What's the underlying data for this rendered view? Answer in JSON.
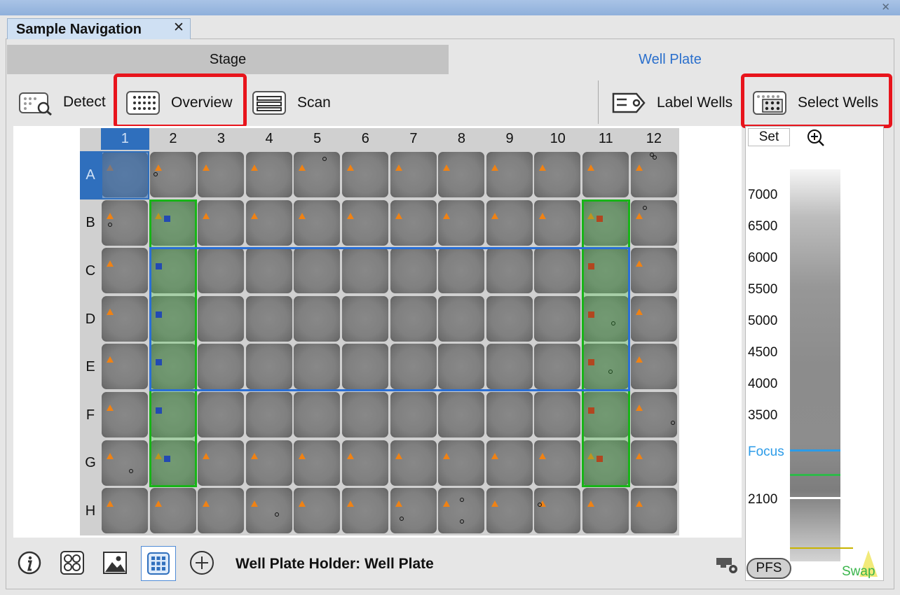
{
  "window": {
    "close_glyph": "✕"
  },
  "tab": {
    "title": "Sample Navigation",
    "close_glyph": "✕"
  },
  "segments": {
    "stage": "Stage",
    "well_plate": "Well Plate"
  },
  "toolbar": {
    "detect": "Detect",
    "overview": "Overview",
    "scan": "Scan",
    "label_wells": "Label Wells",
    "select_wells": "Select Wells"
  },
  "plate": {
    "columns": [
      "1",
      "2",
      "3",
      "4",
      "5",
      "6",
      "7",
      "8",
      "9",
      "10",
      "11",
      "12"
    ],
    "rows": [
      "A",
      "B",
      "C",
      "D",
      "E",
      "F",
      "G",
      "H"
    ],
    "selected_column": "1",
    "selected_row": "A",
    "marker_colors": {
      "triangle": "#f08214",
      "blue_square": "#1a1ae0",
      "red_square": "#e01414"
    },
    "selection_colors": {
      "green": "#17b517",
      "blue": "#2a6fd6"
    }
  },
  "zpanel": {
    "set_label": "Set",
    "zoom_icon": "zoom-in-icon",
    "ticks": [
      "7000",
      "6500",
      "6000",
      "5500",
      "5000",
      "4500",
      "4000",
      "3500"
    ],
    "focus_label": "Focus",
    "lower_tick": "2100",
    "pfs_label": "PFS",
    "swap_label": "Swap"
  },
  "footer": {
    "holder_text": "Well Plate Holder: Well Plate"
  },
  "colors": {
    "accent": "#2a6fcc",
    "highlight_red": "#e8141c"
  }
}
